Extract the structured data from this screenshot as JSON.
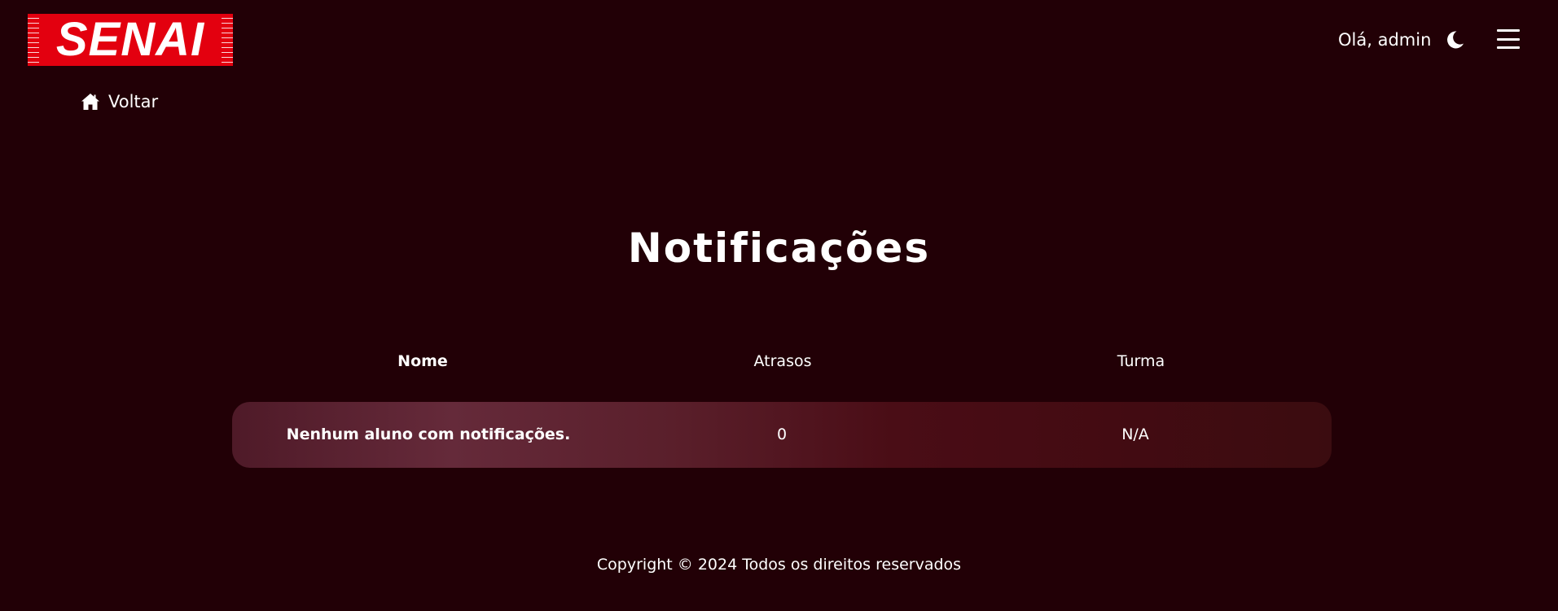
{
  "header": {
    "logo_text": "SENAI",
    "greeting": "Olá, admin",
    "theme_toggle_icon": "moon-icon",
    "menu_icon": "hamburger-menu-icon"
  },
  "nav": {
    "back_label": "Voltar",
    "back_icon": "home-icon"
  },
  "main": {
    "title": "Notificações",
    "table": {
      "columns": [
        "Nome",
        "Atrasos",
        "Turma"
      ],
      "rows": [
        {
          "nome": "Nenhum aluno com notificações.",
          "atrasos": "0",
          "turma": "N/A"
        }
      ]
    }
  },
  "footer": {
    "copyright": "Copyright © 2024 Todos os direitos reservados"
  },
  "colors": {
    "background": "#220006",
    "logo_red": "#e3000f",
    "text": "#ffffff",
    "row_gradient_start": "#4f1a28",
    "row_gradient_end": "#3b0c10"
  }
}
